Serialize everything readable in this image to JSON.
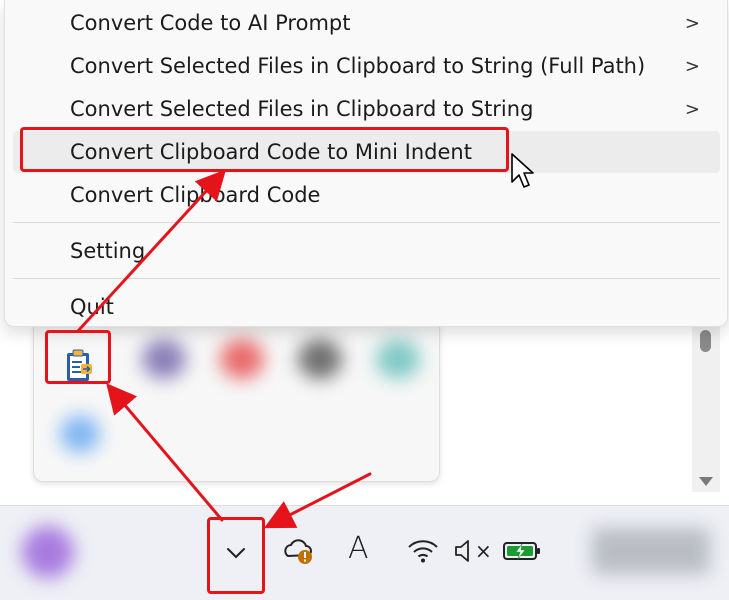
{
  "context_menu": {
    "items": [
      {
        "label": "Convert Code to AI Prompt",
        "has_submenu": true
      },
      {
        "label": "Convert Selected Files in Clipboard to String (Full Path)",
        "has_submenu": true
      },
      {
        "label": "Convert Selected Files in Clipboard to String",
        "has_submenu": true
      },
      {
        "label": "Convert Clipboard Code to Mini Indent",
        "has_submenu": false,
        "hovered": true
      },
      {
        "label": "Convert Clipboard Code",
        "has_submenu": false
      },
      {
        "label": "Setting",
        "has_submenu": false
      },
      {
        "label": "Quit",
        "has_submenu": false
      }
    ],
    "submenu_glyph": ">"
  },
  "tray_flyout": {
    "app_icon": "clipboard-app-icon",
    "blurred_icon_colors": [
      "#8a7fb8",
      "#e96a6a",
      "#6e6e6e",
      "#7fc9c4",
      "#7fb7f2"
    ]
  },
  "taskbar": {
    "chevron_glyph": "⌄",
    "font_glyph": "A",
    "mute_glyph": "×",
    "icons": [
      "chevron-down-icon",
      "onedrive-warning-icon",
      "font-a-icon",
      "wifi-icon",
      "speaker-muted-icon",
      "battery-charging-icon"
    ]
  },
  "colors": {
    "annotation": "#e5141b",
    "menu_bg": "#f9f9f9",
    "hover_bg": "#ececec",
    "taskbar_bg": "#eef0f5",
    "battery_green": "#1e9c34"
  }
}
